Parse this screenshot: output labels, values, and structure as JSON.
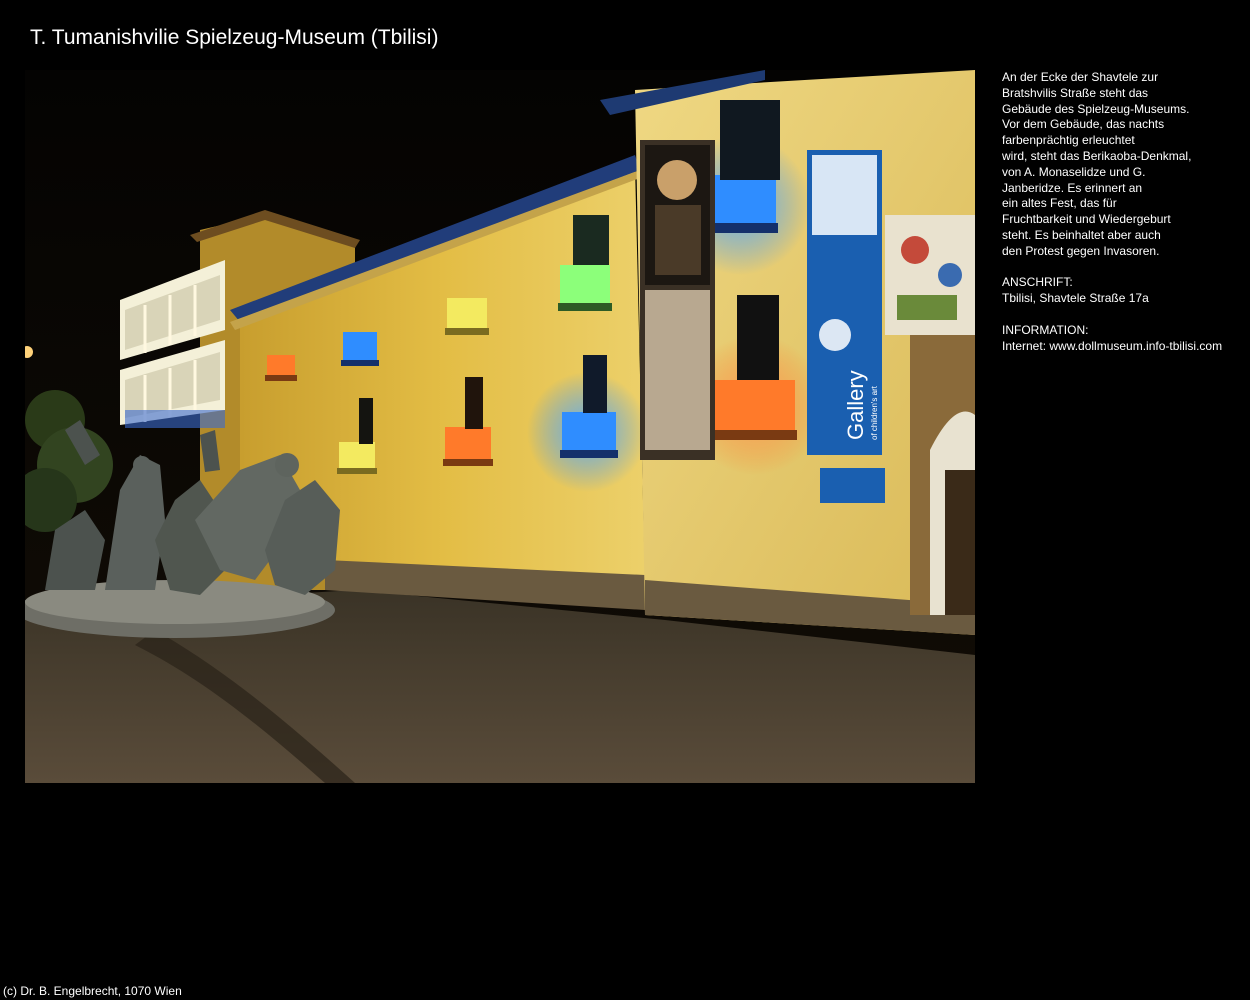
{
  "page": {
    "title": "T. Tumanishvilie Spielzeug-Museum (Tbilisi)"
  },
  "photo": {
    "sign_banner_text": "Gallery",
    "sign_banner_subtext": "of children's art"
  },
  "description": {
    "lines": [
      "An der Ecke der Shavtele zur",
      "Bratshvilis Straße steht das",
      "Gebäude des Spielzeug-Museums.",
      "Vor dem Gebäude, das nachts",
      "farbenprächtig erleuchtet",
      "wird, steht das Berikaoba-Denkmal,",
      "von A. Monaselidze und G.",
      "Janberidze. Es erinnert an",
      "ein altes Fest, das für",
      "Fruchtbarkeit und Wiedergeburt",
      "steht. Es beinhaltet aber auch",
      "den Protest gegen Invasoren."
    ]
  },
  "address": {
    "heading": "ANSCHRIFT:",
    "value": "Tbilisi, Shavtele Straße 17a"
  },
  "information": {
    "heading": "INFORMATION:",
    "value": "Internet: www.dollmuseum.info-tbilisi.com"
  },
  "footer": {
    "copyright": "(c) Dr. B. Engelbrecht, 1070 Wien"
  },
  "colors": {
    "background": "#000000",
    "text": "#ffffff",
    "facade": "#e2c252",
    "balcony_blue": "#2f8dff",
    "balcony_orange": "#ff7a2a",
    "balcony_green": "#8cff7a",
    "balcony_yellow": "#f3ea60"
  }
}
